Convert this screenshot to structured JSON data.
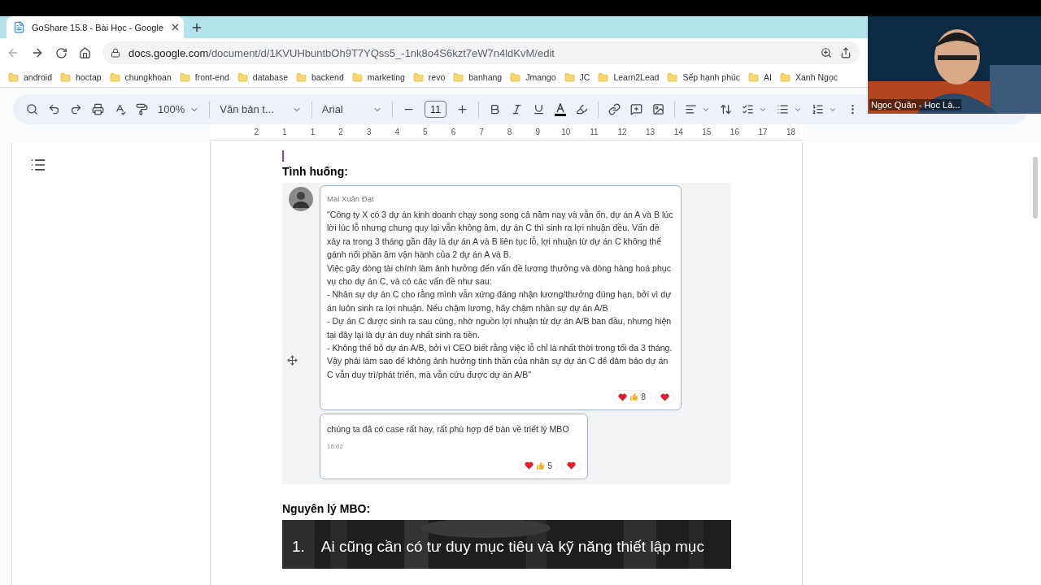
{
  "browser": {
    "tab": {
      "title": "GoShare 15.8 - Bài Học - Google",
      "selected": true
    },
    "url_host": "docs.google.com",
    "url_path": "/document/d/1KVUHbuntbOh9T7YQss5_-1nk8o4S6kzt7eW7n4ldKvM/edit",
    "bookmarks": [
      "android",
      "hoctap",
      "chungkhoan",
      "front-end",
      "database",
      "backend",
      "marketing",
      "revo",
      "banhang",
      "Jmango",
      "JC",
      "Learn2Lead",
      "Sếp hạnh phúc",
      "AI",
      "Xanh Ngọc"
    ]
  },
  "toolbar": {
    "zoom": "100%",
    "style": "Văn bản t...",
    "font": "Arial",
    "font_size": "11"
  },
  "ruler": [
    "2",
    "1",
    "1",
    "2",
    "3",
    "4",
    "5",
    "6",
    "7",
    "8",
    "9",
    "10",
    "11",
    "12",
    "13",
    "14",
    "15",
    "16",
    "17",
    "18"
  ],
  "document": {
    "heading_1": "Tình huống:",
    "chat": {
      "sender": "Mai Xuân Đạt",
      "message": [
        "\"Công ty X có 3 dự án kinh doanh chạy song song cả năm nay và vẫn ổn, dự án A và B lúc lời lúc lỗ nhưng chung quy lại vẫn không âm, dự án C thì sinh ra lợi nhuận đều. Vấn đề xảy ra trong 3 tháng gần đây là dự án A và B liên tục lỗ, lợi nhuận từ dự án C không thể gánh nổi phần âm vận hành của 2 dự án A và B.",
        "Việc gãy dòng tài chính làm ảnh hưởng đến vấn đề lương thưởng và dòng hàng hoá phục vụ cho dự án C, và có các vấn đề như sau:",
        "- Nhân sự dự án C cho rằng mình vẫn xứng đáng nhận lương/thưởng đúng hạn, bởi vì dự án luôn sinh ra lợi nhuận. Nếu chậm lương, hãy chậm nhân sự dự án A/B",
        "- Dự án C được sinh ra sau cùng, nhờ nguồn lợi nhuận từ dự án A/B ban đầu, nhưng hiện tại đây lại là dự án duy nhất sinh ra tiền.",
        "- Không thể bỏ dự án A/B, bởi vì CEO biết rằng việc lỗ chỉ là nhất thời trong tối đa 3 tháng.",
        "Vậy phải làm sao để không ảnh hưởng tinh thần của nhân sự dự án C để đảm bảo dự án C vẫn duy trì/phát triển, mà vẫn cứu được dự án A/B\""
      ],
      "reaction_count": "8",
      "reply": "chúng ta đã có case rất hay, rất phù hợp để bàn về triết lý MBO",
      "reply_time": "16:02",
      "reply_reaction_count": "5"
    },
    "heading_2": "Nguyên lý MBO:",
    "banner": {
      "number": "1.",
      "text": "Ai cũng cần có tư duy mục tiêu và kỹ năng thiết lập mục"
    }
  },
  "video": {
    "kind": "picture",
    "name": "Ngọc Quân - Học Là..."
  }
}
